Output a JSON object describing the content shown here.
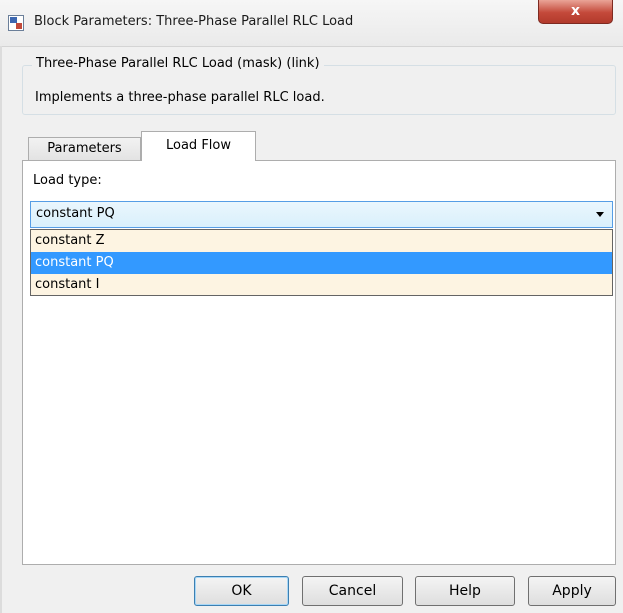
{
  "window": {
    "title": "Block Parameters: Three-Phase Parallel RLC Load",
    "close_label": "x"
  },
  "mask": {
    "legend": "Three-Phase Parallel RLC Load (mask) (link)",
    "description": "Implements a three-phase parallel RLC load."
  },
  "tabs": [
    {
      "label": "Parameters",
      "active": false
    },
    {
      "label": "Load Flow",
      "active": true
    }
  ],
  "load_flow": {
    "load_type_label": "Load type:",
    "selected_value": "constant PQ",
    "options": [
      "constant Z",
      "constant PQ",
      "constant I"
    ],
    "highlighted_index": 1
  },
  "buttons": {
    "ok": "OK",
    "cancel": "Cancel",
    "help": "Help",
    "apply": "Apply"
  },
  "colors": {
    "highlight": "#3399ff",
    "listbox_bg": "#fdf4e2",
    "close_button": "#c4493a"
  },
  "icons": {
    "window": "simulink-block-icon",
    "dropdown": "chevron-down-icon",
    "close": "close-icon"
  }
}
